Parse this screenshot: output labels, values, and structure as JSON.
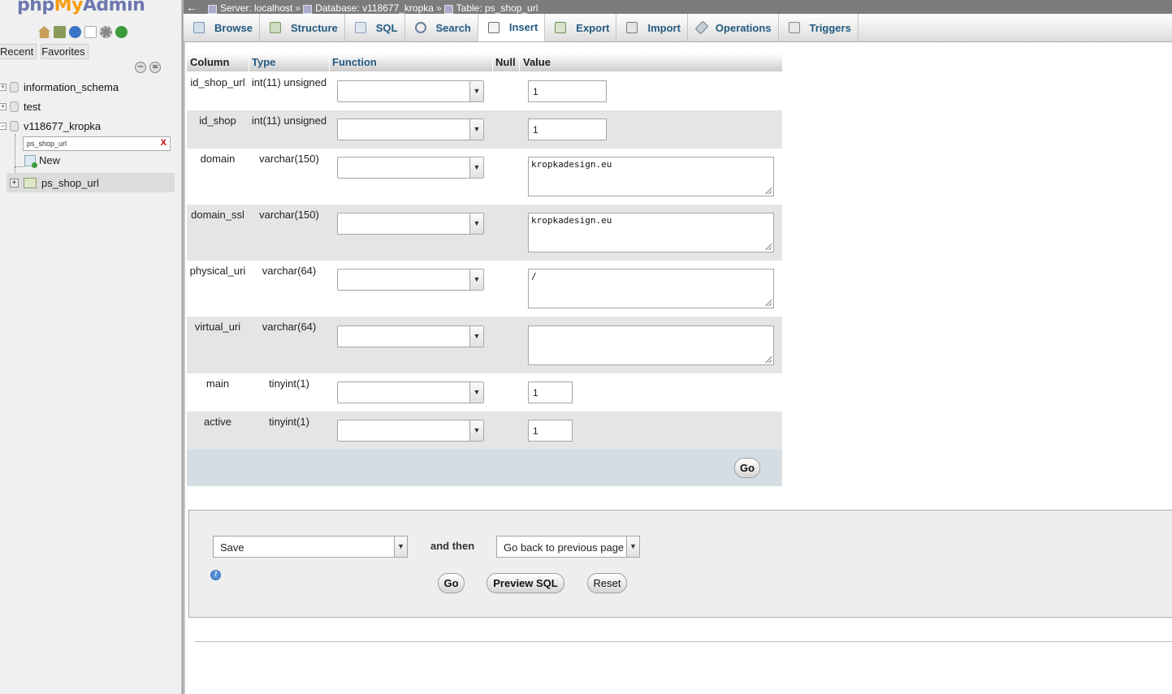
{
  "logo": {
    "php": "php",
    "my": "My",
    "admin": "Admin"
  },
  "nav": {
    "icons": [
      "home-icon",
      "database-icon",
      "help-icon",
      "documentation-icon",
      "settings-icon",
      "reload-icon"
    ],
    "tabs": [
      "Recent",
      "Favorites"
    ],
    "databases": [
      {
        "name": "information_schema"
      },
      {
        "name": "test"
      },
      {
        "name": "v118677_kropka"
      }
    ],
    "filter_value": "ps_shop_url",
    "filter_clear": "X",
    "new_label": "New",
    "table_name": "ps_shop_url"
  },
  "breadcrumb": {
    "back_arrow": "←",
    "server": "Server: localhost",
    "database": "Database: v118677_kropka",
    "table": "Table: ps_shop_url",
    "separator": "»"
  },
  "tabs": [
    {
      "label": "Browse",
      "icon": "browse-icon"
    },
    {
      "label": "Structure",
      "icon": "structure-icon"
    },
    {
      "label": "SQL",
      "icon": "sql-icon"
    },
    {
      "label": "Search",
      "icon": "search-icon"
    },
    {
      "label": "Insert",
      "icon": "insert-icon",
      "active": true
    },
    {
      "label": "Export",
      "icon": "export-icon"
    },
    {
      "label": "Import",
      "icon": "import-icon"
    },
    {
      "label": "Operations",
      "icon": "operations-icon"
    },
    {
      "label": "Triggers",
      "icon": "triggers-icon"
    }
  ],
  "insert_form": {
    "headers": {
      "column": "Column",
      "type": "Type",
      "function": "Function",
      "null": "Null",
      "value": "Value"
    },
    "rows": [
      {
        "column": "id_shop_url",
        "type": "int(11) unsigned",
        "function": "",
        "value": "1"
      },
      {
        "column": "id_shop",
        "type": "int(11) unsigned",
        "function": "",
        "value": "1"
      },
      {
        "column": "domain",
        "type": "varchar(150)",
        "function": "",
        "value": "kropkadesign.eu"
      },
      {
        "column": "domain_ssl",
        "type": "varchar(150)",
        "function": "",
        "value": "kropkadesign.eu"
      },
      {
        "column": "physical_uri",
        "type": "varchar(64)",
        "function": "",
        "value": "/"
      },
      {
        "column": "virtual_uri",
        "type": "varchar(64)",
        "function": "",
        "value": ""
      },
      {
        "column": "main",
        "type": "tinyint(1)",
        "function": "",
        "value": "1"
      },
      {
        "column": "active",
        "type": "tinyint(1)",
        "function": "",
        "value": "1"
      }
    ],
    "go_label": "Go"
  },
  "actions": {
    "action_select": "Save",
    "and_then_label": "and then",
    "after_select": "Go back to previous page",
    "go_label": "Go",
    "preview_sql_label": "Preview SQL",
    "reset_label": "Reset"
  }
}
